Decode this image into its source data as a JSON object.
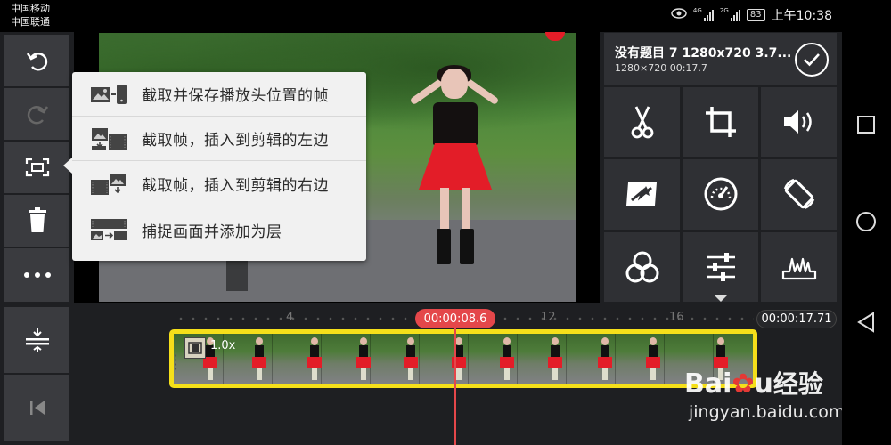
{
  "status_bar": {
    "carrier_1": "中国移动",
    "carrier_2": "中国联通",
    "signal_1_tag": "4G",
    "signal_2_tag": "2G",
    "battery": "83",
    "time": "上午10:38"
  },
  "left_toolbar": {
    "items": [
      "undo-icon",
      "redo-icon",
      "capture-frame-icon",
      "delete-icon",
      "more-icon",
      "align-icon",
      "skip-to-start-icon"
    ]
  },
  "capture_menu": {
    "items": [
      {
        "label": "截取并保存播放头位置的帧",
        "icon": "save-frame-icon"
      },
      {
        "label": "截取帧，插入到剪辑的左边",
        "icon": "insert-frame-left-icon"
      },
      {
        "label": "截取帧，插入到剪辑的右边",
        "icon": "insert-frame-right-icon"
      },
      {
        "label": "捕捉画面并添加为层",
        "icon": "capture-as-layer-icon"
      }
    ]
  },
  "project": {
    "title": "没有题目 7 1280x720 3.7...",
    "subtitle": "1280×720  00:17.7"
  },
  "tools_grid": {
    "items": [
      "scissors-icon",
      "crop-icon",
      "volume-icon",
      "effect-icon",
      "speed-icon",
      "rotate-icon",
      "color-filter-icon",
      "adjust-icon",
      "audio-wave-icon"
    ]
  },
  "timeline": {
    "ruler_labels": [
      "4",
      "12",
      "16"
    ],
    "playhead_time": "00:00:08.6",
    "total_time": "00:00:17.71",
    "clip_speed": "1.0x"
  },
  "watermark": {
    "logo_latin": "Bai",
    "logo_latin_2": "u",
    "logo_cn": "经验",
    "url": "jingyan.baidu.com"
  }
}
